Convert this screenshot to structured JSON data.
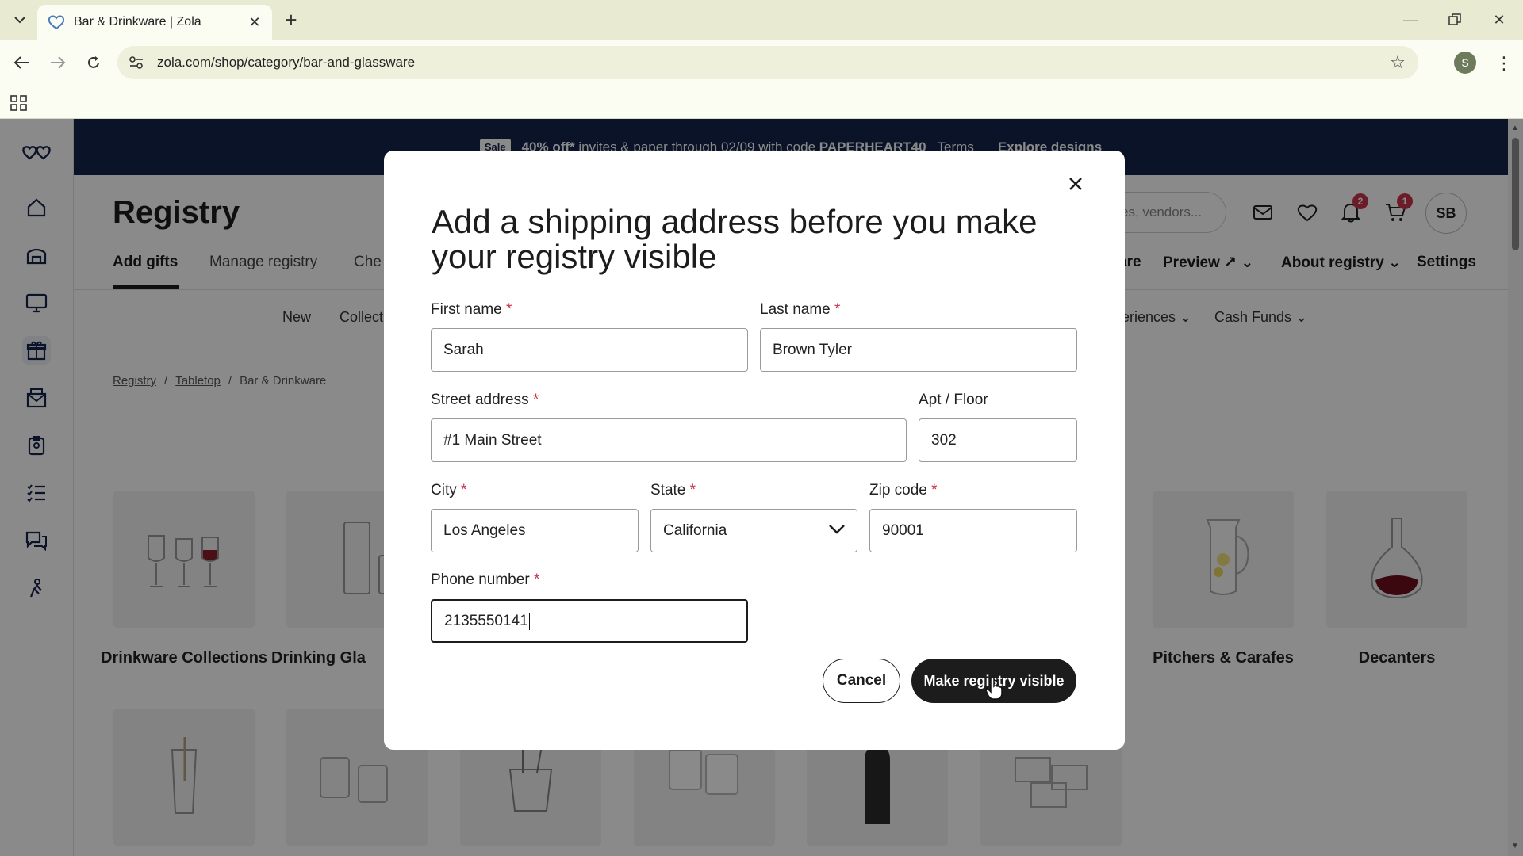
{
  "browser": {
    "tab_title": "Bar & Drinkware | Zola",
    "url": "zola.com/shop/category/bar-and-glassware",
    "profile_initial": "S"
  },
  "promo": {
    "tag": "Sale",
    "text_prefix": "40% off*",
    "text_mid": " invites & paper through 02/09 with code ",
    "code": "PAPERHEART40",
    "terms": "Terms",
    "cta": "Explore designs"
  },
  "header": {
    "title": "Registry",
    "search_placeholder": "es, vendors...",
    "notifications_count": "2",
    "cart_count": "1",
    "avatar_initials": "SB"
  },
  "subnav": {
    "add_gifts": "Add gifts",
    "manage": "Manage registry",
    "che": "Che",
    "share": "are",
    "preview": "Preview",
    "about": "About registry",
    "settings": "Settings"
  },
  "catnav": {
    "new": "New",
    "collections": "Collect",
    "experiences": "eriences",
    "cash_funds": "Cash Funds"
  },
  "breadcrumb": {
    "registry": "Registry",
    "tabletop": "Tabletop",
    "current": "Bar & Drinkware"
  },
  "tiles": {
    "drinkware_collections": "Drinkware Collections",
    "drinking_glasses": "Drinking Gla",
    "pitchers": "Pitchers & Carafes",
    "decanters": "Decanters"
  },
  "modal": {
    "title": "Add a shipping address before you make your registry visible",
    "first_name_label": "First name",
    "first_name": "Sarah",
    "last_name_label": "Last name",
    "last_name": "Brown Tyler",
    "street_label": "Street address",
    "street": "#1 Main Street",
    "apt_label": "Apt / Floor",
    "apt": "302",
    "city_label": "City",
    "city": "Los Angeles",
    "state_label": "State",
    "state": "California",
    "zip_label": "Zip code",
    "zip": "90001",
    "phone_label": "Phone number",
    "phone": "2135550141",
    "required_mark": "*",
    "cancel": "Cancel",
    "submit": "Make registry visible"
  }
}
